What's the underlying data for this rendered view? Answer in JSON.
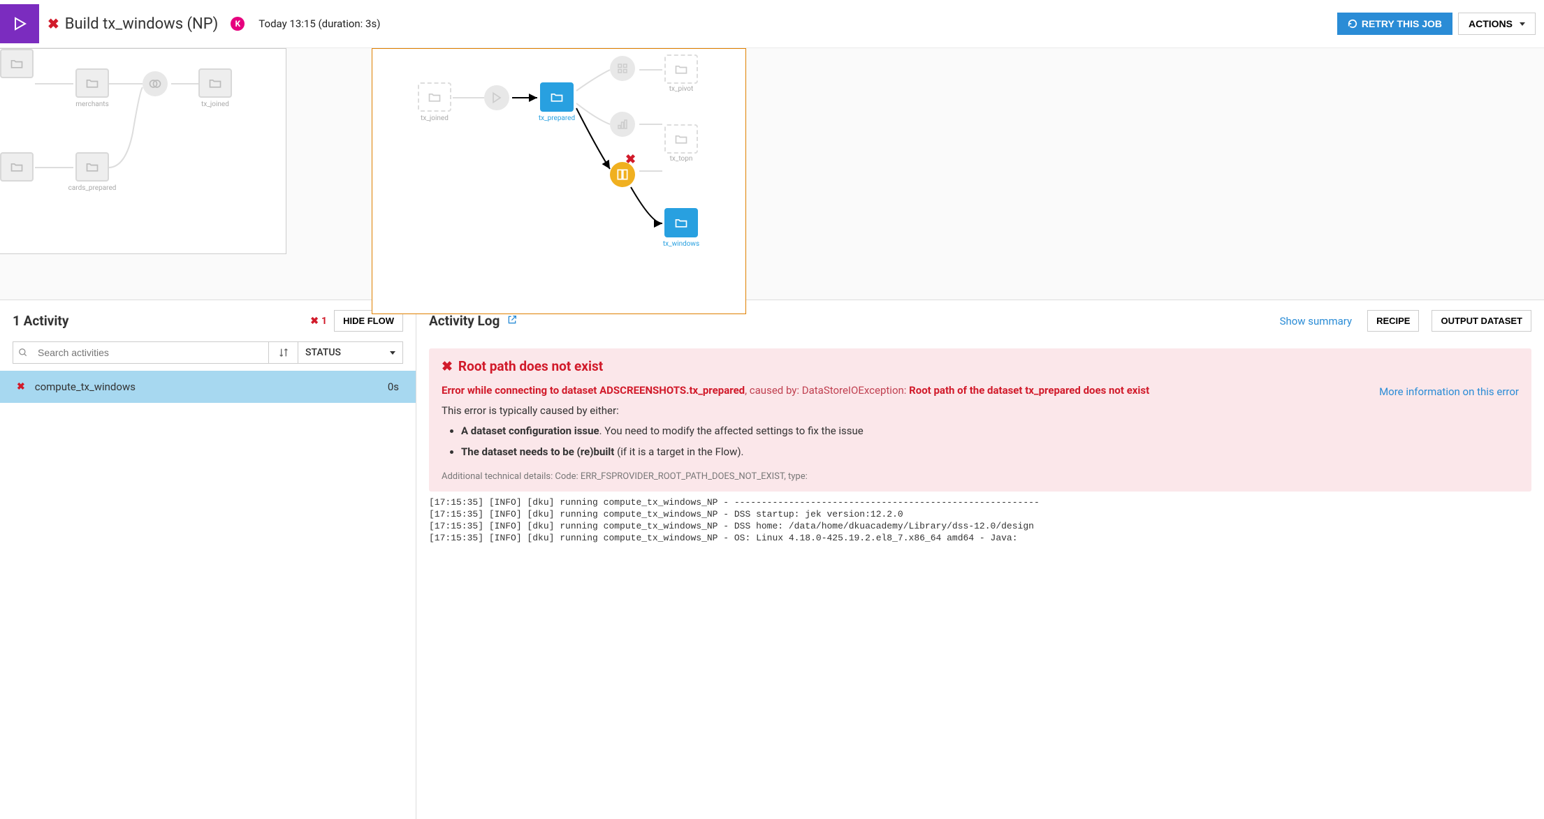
{
  "header": {
    "job_title": "Build tx_windows (NP)",
    "avatar_initial": "K",
    "timestamp": "Today 13:15 (duration: 3s)",
    "retry_label": "RETRY THIS JOB",
    "actions_label": "ACTIONS"
  },
  "flow": {
    "left_nodes": {
      "merchants": "merchants",
      "tx_joined": "tx_joined",
      "cards_prepared": "cards_prepared"
    },
    "main_nodes": {
      "tx_joined": "tx_joined",
      "tx_prepared": "tx_prepared",
      "tx_pivot": "tx_pivot",
      "tx_topn": "tx_topn",
      "tx_windows": "tx_windows"
    }
  },
  "activities": {
    "title": "1 Activity",
    "failed_count": "1",
    "hide_flow_label": "HIDE FLOW",
    "search_placeholder": "Search activities",
    "status_label": "STATUS",
    "rows": [
      {
        "name": "compute_tx_windows",
        "duration": "0s"
      }
    ]
  },
  "log": {
    "title": "Activity Log",
    "show_summary": "Show summary",
    "recipe_btn": "RECIPE",
    "output_btn": "OUTPUT DATASET",
    "error": {
      "title": "Root path does not exist",
      "subtitle_1": "Error while connecting to dataset ADSCREENSHOTS.tx_prepared",
      "caused": ", caused by: DataStoreIOException: ",
      "subtitle_2": "Root path of the dataset tx_prepared does not exist",
      "explain": "This error is typically caused by either:",
      "bullet1_a": "A dataset configuration issue",
      "bullet1_b": ". You need to modify the affected settings to fix the issue",
      "bullet2_a": "The dataset needs to be (re)built",
      "bullet2_b": " (if it is a target in the Flow).",
      "tech": "Additional technical details: Code: ERR_FSPROVIDER_ROOT_PATH_DOES_NOT_EXIST, type:",
      "more_info": "More information on this error"
    },
    "lines": "[17:15:35] [INFO] [dku] running compute_tx_windows_NP - --------------------------------------------------------\n[17:15:35] [INFO] [dku] running compute_tx_windows_NP - DSS startup: jek version:12.2.0\n[17:15:35] [INFO] [dku] running compute_tx_windows_NP - DSS home: /data/home/dkuacademy/Library/dss-12.0/design\n[17:15:35] [INFO] [dku] running compute_tx_windows_NP - OS: Linux 4.18.0-425.19.2.el8_7.x86_64 amd64 - Java:"
  }
}
